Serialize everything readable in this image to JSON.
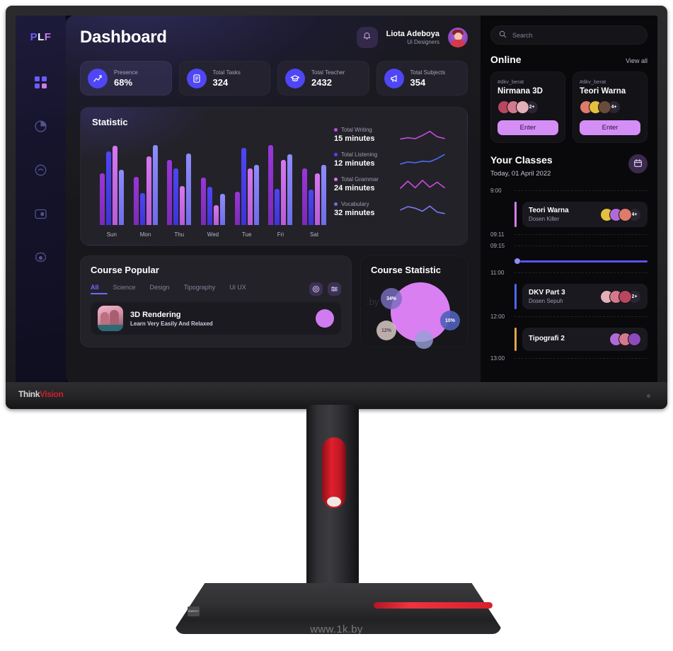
{
  "device": {
    "brand": "Think",
    "brand_accent": "Vision",
    "watermark": "www.1k.by",
    "base_badge": "ENERGY"
  },
  "sidebar": {
    "brand": {
      "p": "P",
      "l": "L",
      "f": "F"
    },
    "items": [
      {
        "name": "dashboard",
        "icon": "grid-icon",
        "active": true
      },
      {
        "name": "analytics",
        "icon": "pie-chart-icon",
        "active": false
      },
      {
        "name": "messages",
        "icon": "chat-icon",
        "active": false
      },
      {
        "name": "schedule",
        "icon": "card-icon",
        "active": false
      },
      {
        "name": "settings",
        "icon": "gear-icon",
        "active": false
      }
    ]
  },
  "header": {
    "title": "Dashboard",
    "notification_icon": "bell-icon",
    "user": {
      "name": "Liota Adeboya",
      "role": "Ui Designers",
      "avatar": "user-avatar"
    }
  },
  "stats": [
    {
      "label": "Presence",
      "value": "68%",
      "icon": "trending-up-icon"
    },
    {
      "label": "Total Tasks",
      "value": "324",
      "icon": "document-icon"
    },
    {
      "label": "Total Teacher",
      "value": "2432",
      "icon": "graduation-cap-icon"
    },
    {
      "label": "Total Subjects",
      "value": "354",
      "icon": "megaphone-icon"
    }
  ],
  "statistic": {
    "title": "Statistic",
    "legend": [
      {
        "name": "Total Writing",
        "value": "15 minutes",
        "color": "#c44ae0"
      },
      {
        "name": "Total Listening",
        "value": "12 minutes",
        "color": "#4f46f5"
      },
      {
        "name": "Total Grammar",
        "value": "24 minutes",
        "color": "#d678ef"
      },
      {
        "name": "Vocabulary",
        "value": "32 minutes",
        "color": "#6f6cea"
      }
    ]
  },
  "chart_data": {
    "type": "bar",
    "title": "Statistic",
    "xlabel": "",
    "ylabel": "",
    "ylim": [
      0,
      100
    ],
    "grid": false,
    "legend_position": "right",
    "categories": [
      "Sun",
      "Mon",
      "Thu",
      "Wed",
      "Tue",
      "Fri",
      "Sat"
    ],
    "series": [
      {
        "name": "Total Writing",
        "color": "#9b36d9",
        "values": [
          62,
          58,
          78,
          57,
          40,
          96,
          68
        ]
      },
      {
        "name": "Total Listening",
        "color": "#4f46f5",
        "values": [
          88,
          38,
          68,
          46,
          92,
          43,
          42
        ]
      },
      {
        "name": "Total Grammar",
        "color": "#d678ef",
        "values": [
          95,
          82,
          47,
          24,
          68,
          78,
          62
        ]
      },
      {
        "name": "Vocabulary",
        "color": "#8f8cfb",
        "values": [
          66,
          96,
          86,
          37,
          72,
          85,
          72
        ]
      }
    ],
    "sparklines": [
      {
        "name": "Total Writing",
        "color": "#c44ae0",
        "values": [
          20,
          30,
          22,
          48,
          80,
          38,
          24
        ]
      },
      {
        "name": "Total Listening",
        "color": "#4f6cf5",
        "values": [
          18,
          34,
          28,
          40,
          36,
          60,
          92
        ]
      },
      {
        "name": "Total Grammar",
        "color": "#d24ae0",
        "values": [
          22,
          78,
          26,
          84,
          30,
          70,
          26
        ]
      },
      {
        "name": "Vocabulary",
        "color": "#7b7cf0",
        "values": [
          46,
          72,
          60,
          36,
          76,
          30,
          18
        ]
      }
    ]
  },
  "course_popular": {
    "title": "Course Popular",
    "tabs": [
      {
        "label": "All",
        "active": true
      },
      {
        "label": "Science",
        "active": false
      },
      {
        "label": "Design",
        "active": false
      },
      {
        "label": "Tipography",
        "active": false
      },
      {
        "label": "Ui UX",
        "active": false
      }
    ],
    "tools": [
      {
        "name": "settings-icon"
      },
      {
        "name": "filter-icon"
      }
    ],
    "items": [
      {
        "title": "3D Rendering",
        "subtitle": "Learn Very Easily And Relaxed",
        "thumb": "3d-render-thumbnail"
      }
    ]
  },
  "course_statistic": {
    "title": "Course Statistic",
    "watermark": ".by",
    "chart": {
      "type": "pie",
      "slices": [
        {
          "label": "34%",
          "value": 34,
          "color": "#786ebe"
        },
        {
          "label": "10%",
          "value": 10,
          "color": "#505fb9"
        },
        {
          "label": "12%",
          "value": 12,
          "color": "#d7c8c3"
        },
        {
          "label": "",
          "value": 8,
          "color": "#96a0d7"
        }
      ],
      "main_color": "#d97ff2"
    }
  },
  "search": {
    "placeholder": "Search",
    "icon": "search-icon"
  },
  "online": {
    "title": "Online",
    "view_all": "View all",
    "cards": [
      {
        "tag": "#dkv_berat",
        "title": "Nirmana 3D",
        "more_count": "2+",
        "button": "Enter",
        "avatars": [
          "#b8465f",
          "#d4798c",
          "#e2b0b8"
        ]
      },
      {
        "tag": "#dkv_berat",
        "title": "Teori Warna",
        "more_count": "4+",
        "button": "Enter",
        "avatars": [
          "#e07a6a",
          "#e3c03f",
          "#6a4a3c"
        ]
      }
    ]
  },
  "classes": {
    "title": "Your Classes",
    "date": "Today, 01 April 2022",
    "calendar_icon": "calendar-icon",
    "times": [
      "9:00",
      "09:11",
      "09:15",
      "11:00",
      "12:00",
      "13:00"
    ],
    "events": [
      {
        "title": "Teori Warna",
        "teacher": "Dosen Killer",
        "more_count": "4+",
        "color": "#d77bf0",
        "avatars": [
          "#e3c03f",
          "#b06ad8",
          "#e07a6a"
        ]
      },
      {
        "title": "DKV Part 3",
        "teacher": "Dosen Sepuh",
        "more_count": "2+",
        "color": "#4f66f5",
        "avatars": [
          "#e2b0b8",
          "#d4798c",
          "#b8465f"
        ]
      },
      {
        "title": "Tipografi 2",
        "teacher": "",
        "more_count": "",
        "color": "#e0a44a",
        "avatars": [
          "#b06ad8",
          "#d4798c",
          "#8e49bb"
        ]
      }
    ],
    "now_marker": "current-time-marker"
  }
}
